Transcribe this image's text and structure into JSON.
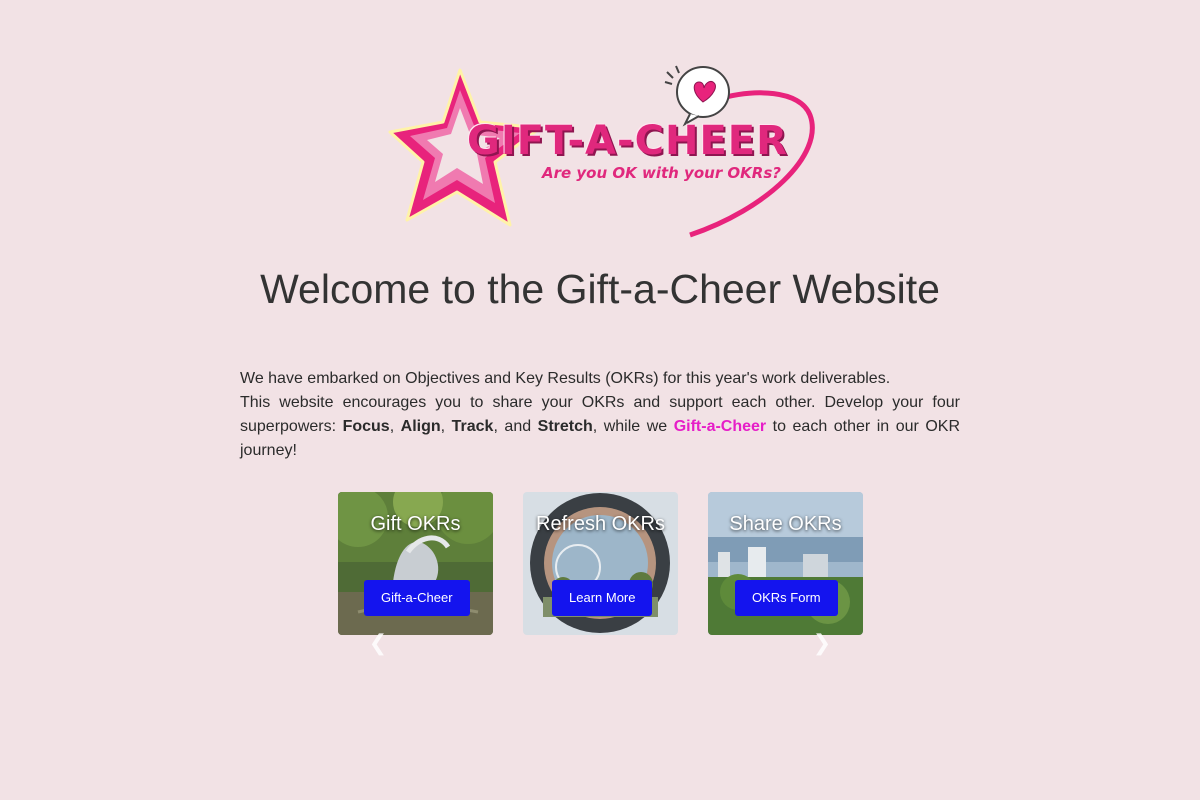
{
  "logo": {
    "title": "GIFT-A-CHEER",
    "tagline": "Are you OK with your OKRs?",
    "accent_color": "#e0287d",
    "icon": "star-heart-logo"
  },
  "heading": "Welcome to the Gift-a-Cheer Website",
  "intro": {
    "line1": "We have embarked on Objectives and Key Results (OKRs) for this year's work deliverables.",
    "line2_start": "This website encourages you to share your OKRs and support each other. Develop your four superpowers: ",
    "focus": "Focus",
    "sep1": ", ",
    "align": "Align",
    "sep2": ", ",
    "track": "Track",
    "sep3": ", and ",
    "stretch": "Stretch",
    "mid": ", while we ",
    "brand": "Gift-a-Cheer",
    "end": " to each other in our OKR journey!",
    "brand_color": "#e61ec8"
  },
  "carousel": {
    "cards": [
      {
        "title": "Gift OKRs",
        "button": "Gift-a-Cheer"
      },
      {
        "title": "Refresh OKRs",
        "button": "Learn More"
      },
      {
        "title": "Share OKRs",
        "button": "OKRs Form"
      }
    ],
    "prev_icon": "chevron-left-icon",
    "next_icon": "chevron-right-icon",
    "button_color": "#1414ee"
  }
}
